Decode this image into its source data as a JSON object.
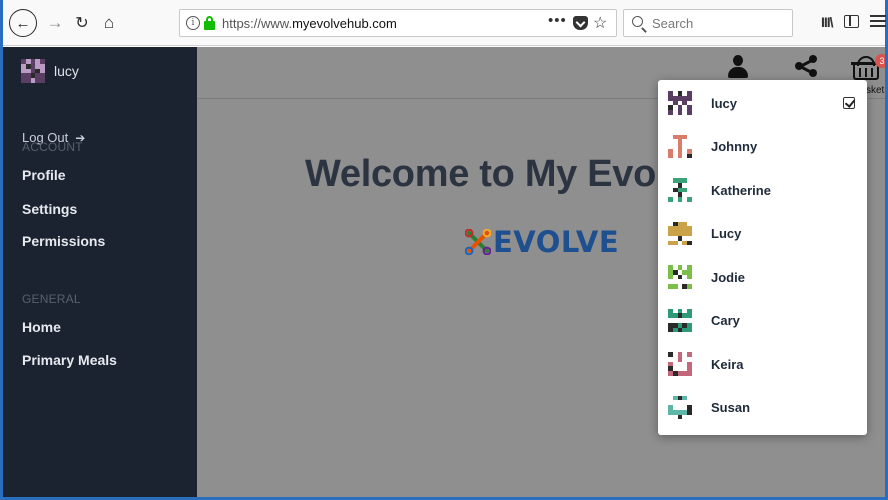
{
  "browser": {
    "url_prefix": "https://www.",
    "url_domain": "myevolvehub.com",
    "more_label": "•••",
    "search_placeholder": "Search",
    "library_label": "III\\"
  },
  "sidebar": {
    "brand_name": "lucy",
    "logout_label": "Log Out",
    "sections": [
      {
        "label": "ACCOUNT",
        "items": [
          "Profile",
          "Settings",
          "Permissions"
        ]
      },
      {
        "label": "GENERAL",
        "items": [
          "Home",
          "Primary Meals"
        ]
      }
    ]
  },
  "topbar": {
    "basket_label": "sket",
    "basket_badge": "3"
  },
  "main": {
    "welcome": "Welcome to My Evo",
    "logo_text": "EVOLVE"
  },
  "dropdown": {
    "users": [
      {
        "name": "lucy",
        "selected": true,
        "avatar_color": "#5a3e64"
      },
      {
        "name": "Johnny",
        "selected": false,
        "avatar_color": "#d97c6a"
      },
      {
        "name": "Katherine",
        "selected": false,
        "avatar_color": "#3aa37a"
      },
      {
        "name": "Lucy",
        "selected": false,
        "avatar_color": "#c9a24a"
      },
      {
        "name": "Jodie",
        "selected": false,
        "avatar_color": "#7bbf4a"
      },
      {
        "name": "Cary",
        "selected": false,
        "avatar_color": "#2f9a7a"
      },
      {
        "name": "Keira",
        "selected": false,
        "avatar_color": "#c4677d"
      },
      {
        "name": "Susan",
        "selected": false,
        "avatar_color": "#5fb5a8"
      }
    ]
  },
  "colors": {
    "sidebar_bg": "#1b2330",
    "page_overlay": "#8f8f8f",
    "logo_blue": "#1e4f8f",
    "secure_green": "#12bc00"
  }
}
